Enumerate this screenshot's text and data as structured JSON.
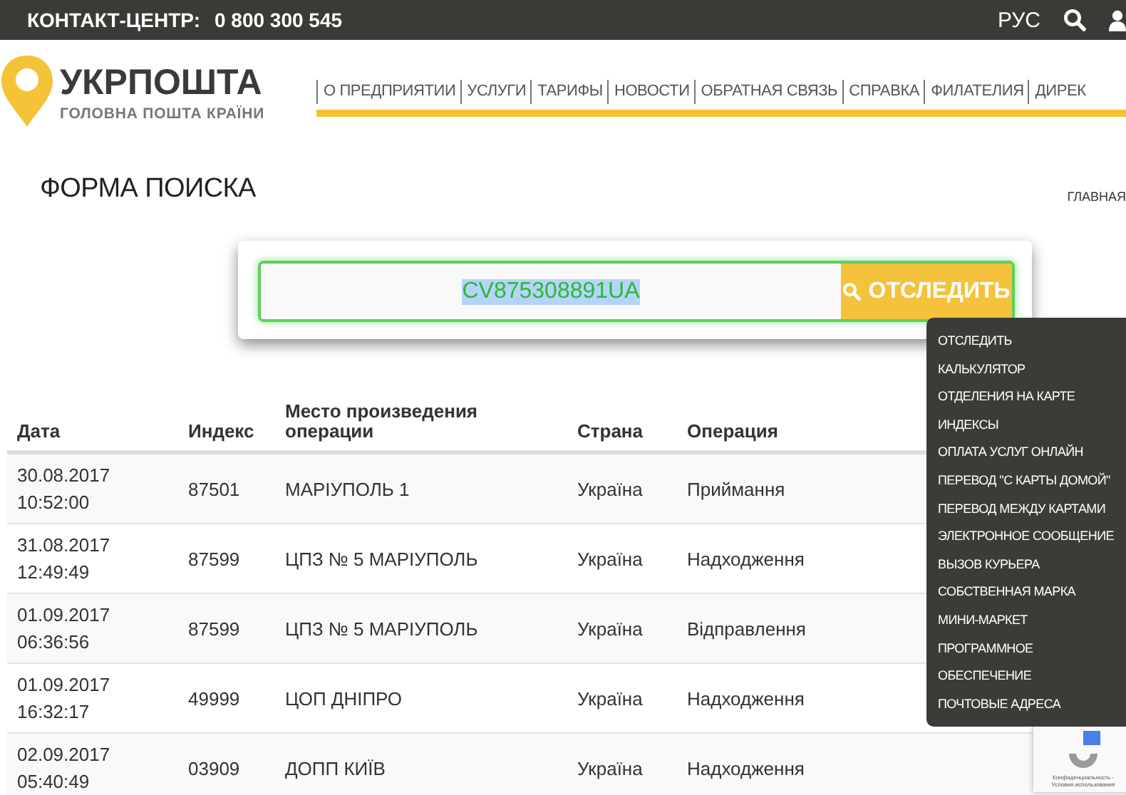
{
  "top_bar": {
    "contact_label": "КОНТАКТ-ЦЕНТР:",
    "phone": "0 800 300 545",
    "language": "РУС"
  },
  "logo": {
    "name": "УКРПОШТА",
    "tagline": "ГОЛОВНА ПОШТА КРАЇНИ"
  },
  "nav": {
    "items": [
      "О ПРЕДПРИЯТИИ",
      "УСЛУГИ",
      "ТАРИФЫ",
      "НОВОСТИ",
      "ОБРАТНАЯ СВЯЗЬ",
      "СПРАВКА",
      "ФИЛАТЕЛИЯ",
      "ДИРЕК"
    ]
  },
  "page_title": "ФОРМА ПОИСКА",
  "breadcrumb": "ГЛАВНАЯ",
  "search": {
    "value": "CV875308891UA",
    "value_selected": true,
    "button": "ОТСЛЕДИТЬ"
  },
  "table": {
    "columns": [
      "Дата",
      "Индекс",
      "Место произведения операции",
      "Страна",
      "Операция"
    ],
    "rows": [
      [
        "30.08.2017 10:52:00",
        "87501",
        "МАРІУПОЛЬ 1",
        "Україна",
        "Приймання"
      ],
      [
        "31.08.2017 12:49:49",
        "87599",
        "ЦПЗ № 5 МАРІУПОЛЬ",
        "Україна",
        "Надходження"
      ],
      [
        "01.09.2017 06:36:56",
        "87599",
        "ЦПЗ № 5 МАРІУПОЛЬ",
        "Україна",
        "Відправлення"
      ],
      [
        "01.09.2017 16:32:17",
        "49999",
        "ЦОП ДНІПРО",
        "Україна",
        "Надходження"
      ],
      [
        "02.09.2017 05:40:49",
        "03909",
        "ДОПП КИЇВ",
        "Україна",
        "Надходження"
      ]
    ]
  },
  "menu": {
    "items": [
      "ОТСЛЕДИТЬ",
      "КАЛЬКУЛЯТОР",
      "ОТДЕЛЕНИЯ НА КАРТЕ",
      "ИНДЕКСЫ",
      "ОПЛАТА УСЛУГ ОНЛАЙН",
      "ПЕРЕВОД \"С КАРТЫ ДОМОЙ\"",
      "ПЕРЕВОД МЕЖДУ КАРТАМИ",
      "ЭЛЕКТРОННОЕ СООБЩЕНИЕ",
      "ВЫЗОВ КУРЬЕРА",
      "СОБСТВЕННАЯ МАРКА",
      "МИНИ-МАРКЕТ",
      "ПРОГРАММНОЕ",
      "ОБЕСПЕЧЕНИЕ",
      "ПОЧТОВЫЕ АДРЕСА"
    ]
  },
  "recaptcha": {
    "lines": [
      "Конфиденциальность -",
      "Условия использования"
    ]
  }
}
